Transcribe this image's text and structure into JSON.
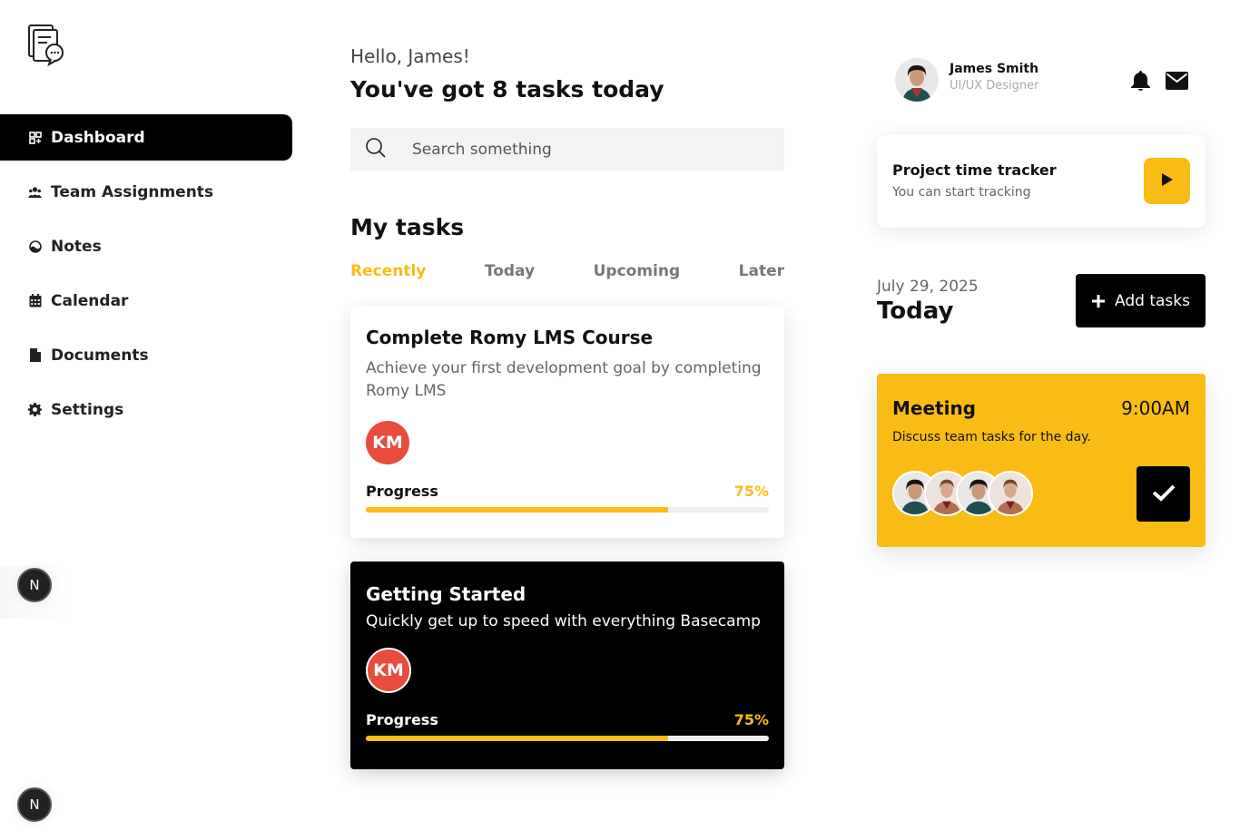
{
  "sidebar": {
    "logo_icon": "document-chat-icon",
    "items": [
      {
        "label": "Dashboard",
        "icon": "dashboard-icon",
        "active": true
      },
      {
        "label": "Team Assignments",
        "icon": "team-icon"
      },
      {
        "label": "Notes",
        "icon": "notes-icon"
      },
      {
        "label": "Calendar",
        "icon": "calendar-icon"
      },
      {
        "label": "Documents",
        "icon": "document-icon"
      },
      {
        "label": "Settings",
        "icon": "gear-icon"
      }
    ],
    "fab_label": "N"
  },
  "header": {
    "greeting": "Hello, James!",
    "headline": "You've got 8 tasks today"
  },
  "search": {
    "placeholder": "Search something"
  },
  "tasks": {
    "title": "My tasks",
    "tabs": [
      "Recently",
      "Today",
      "Upcoming",
      "Later"
    ],
    "active_tab": "Recently",
    "cards": [
      {
        "title": "Complete Romy LMS Course",
        "description": "Achieve your first development goal by completing Romy LMS",
        "assignee_initials": "KM",
        "progress_label": "Progress",
        "progress_text": "75%",
        "progress": 0.75,
        "theme": "light"
      },
      {
        "title": "Getting Started",
        "description": "Quickly get up to speed with everything Basecamp",
        "assignee_initials": "KM",
        "progress_label": "Progress",
        "progress_text": "75%",
        "progress": 0.75,
        "theme": "dark"
      }
    ]
  },
  "user": {
    "name": "James Smith",
    "role": "UI/UX Designer"
  },
  "tracker": {
    "title": "Project time tracker",
    "subtitle": "You can start tracking"
  },
  "schedule": {
    "date": "July 29, 2025",
    "day_label": "Today",
    "add_label": "Add tasks"
  },
  "meeting": {
    "title": "Meeting",
    "time": "9:00AM",
    "description": "Discuss team tasks for the day."
  },
  "colors": {
    "accent": "#f9bc15",
    "dark": "#000000",
    "avatar_red": "#e74c3c"
  }
}
